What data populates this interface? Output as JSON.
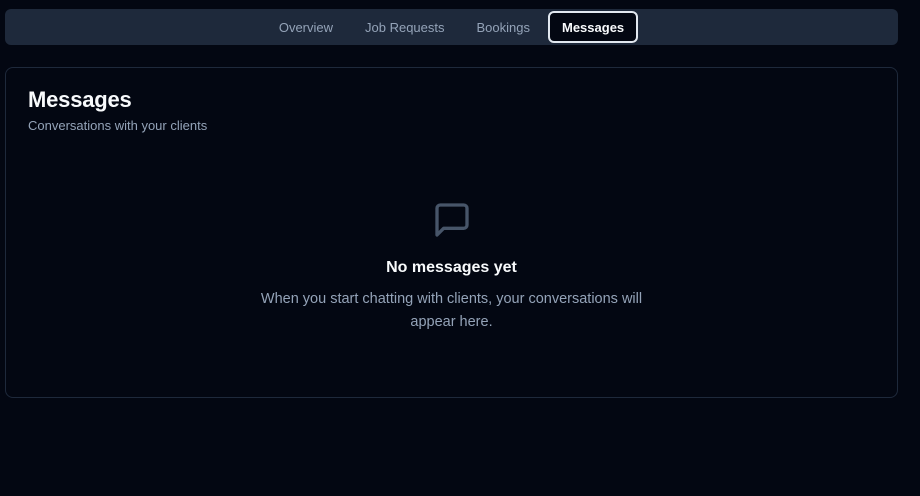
{
  "tabs": [
    {
      "label": "Overview",
      "active": false
    },
    {
      "label": "Job Requests",
      "active": false
    },
    {
      "label": "Bookings",
      "active": false
    },
    {
      "label": "Messages",
      "active": true
    }
  ],
  "card": {
    "title": "Messages",
    "subtitle": "Conversations with your clients"
  },
  "empty_state": {
    "icon": "message-square-icon",
    "title": "No messages yet",
    "description": "When you start chatting with clients, your conversations will appear here."
  },
  "colors": {
    "background": "#030712",
    "tabbar": "#1e293b",
    "text_primary": "#f8fafc",
    "text_muted": "#94a3b8",
    "icon": "#475569"
  }
}
